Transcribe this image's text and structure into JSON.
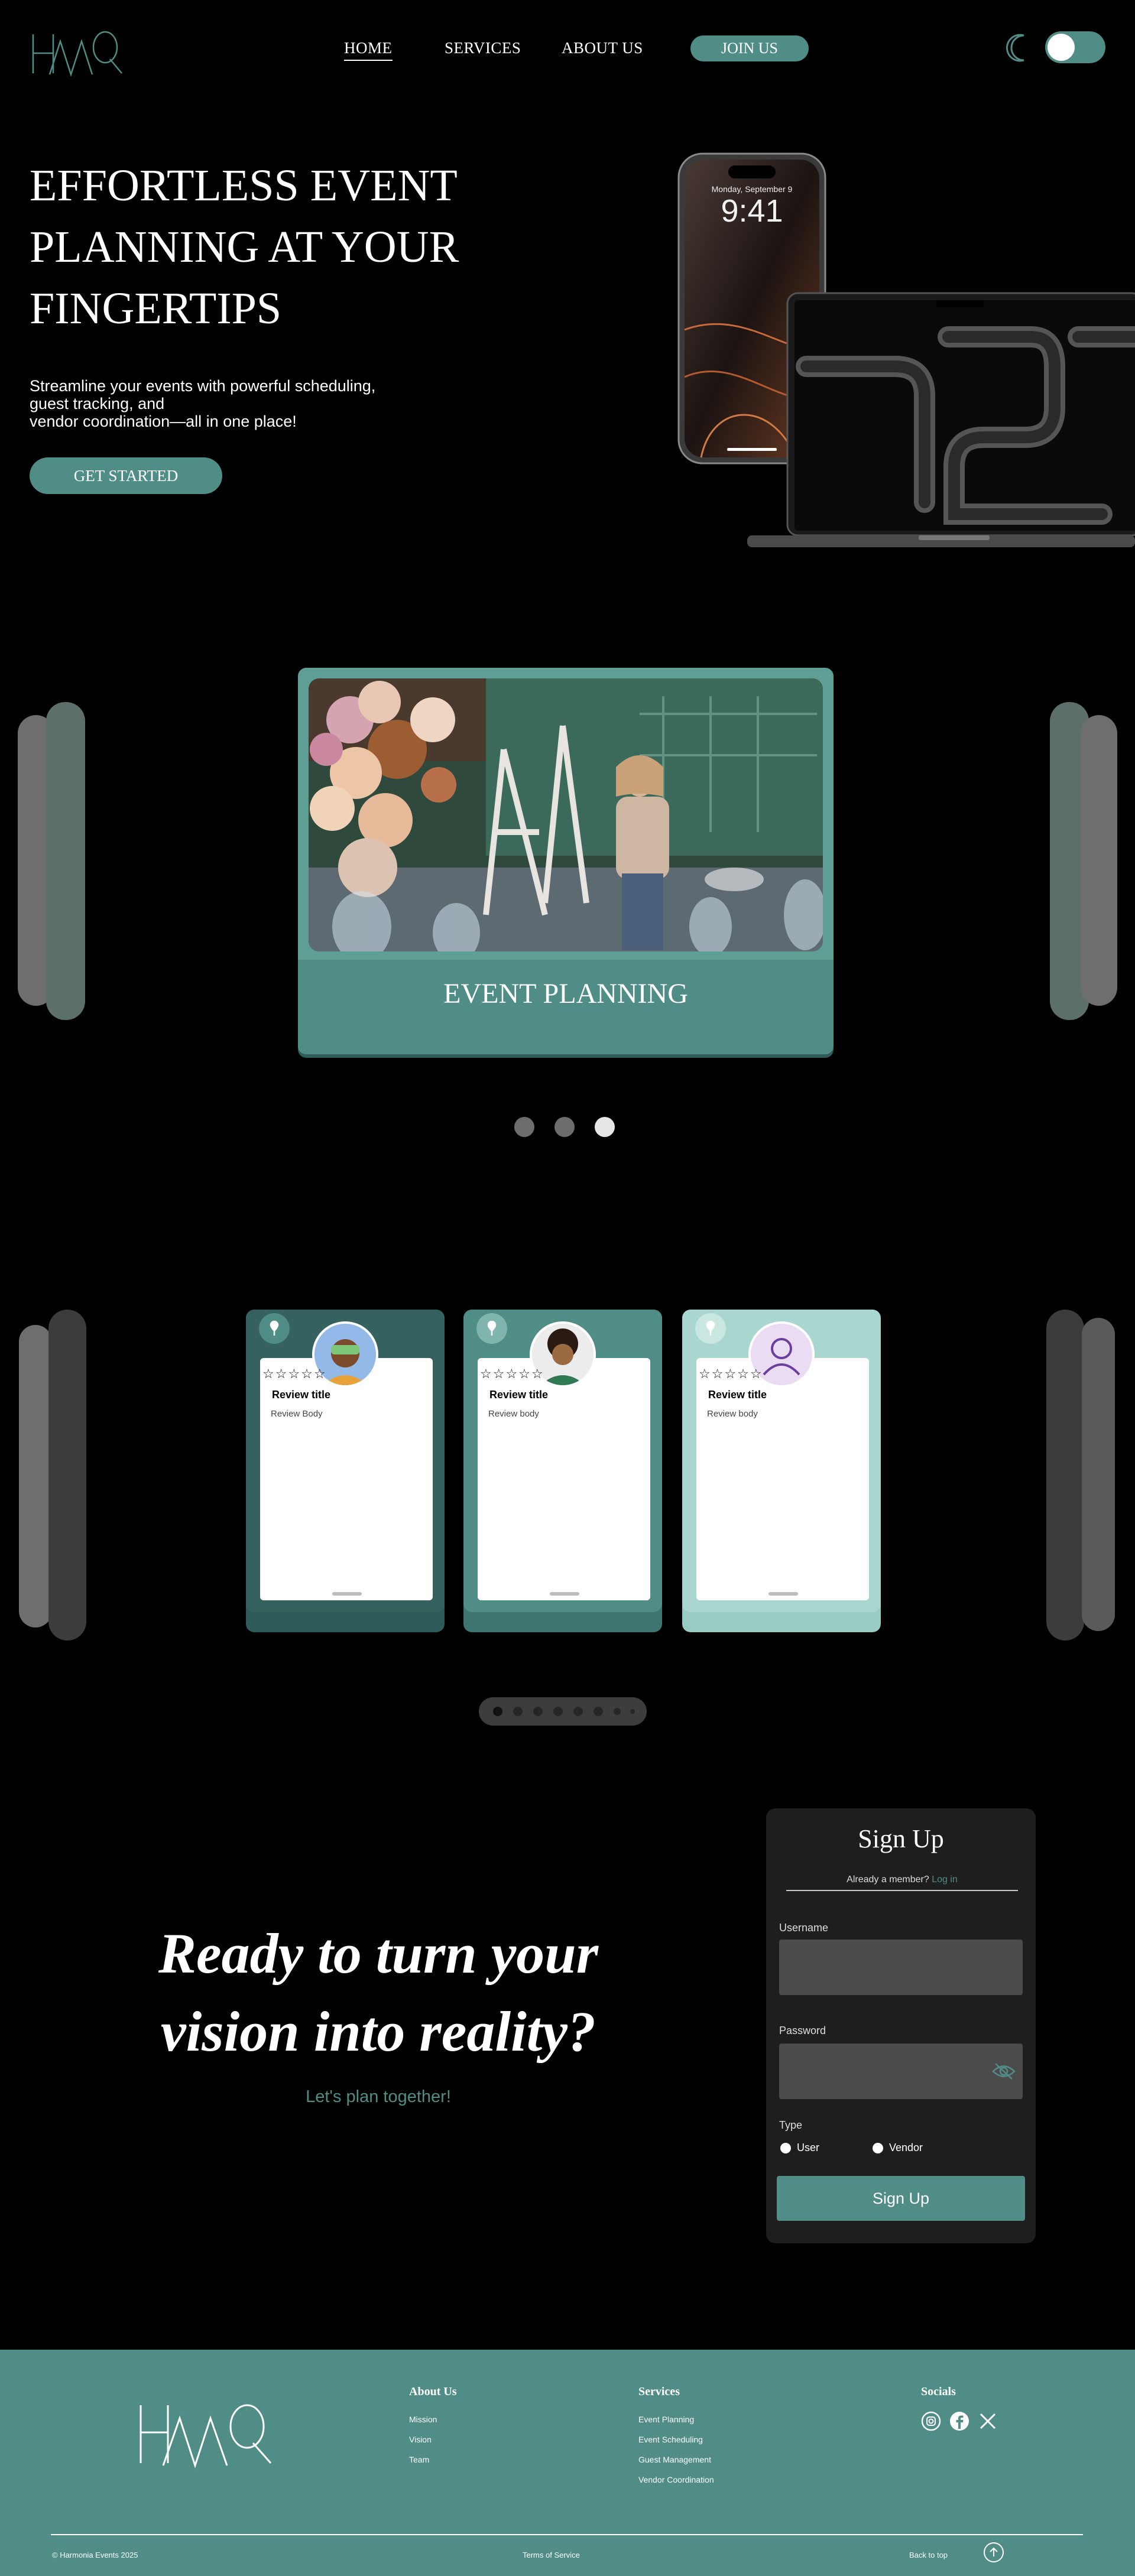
{
  "nav": {
    "logo": "HMQ",
    "links": [
      "HOME",
      "SERVICES",
      "ABOUT US"
    ],
    "join": "JOIN US"
  },
  "hero": {
    "title": "EFFORTLESS EVENT PLANNING AT YOUR FINGERTIPS",
    "subtitle_lines": [
      "Streamline your events with powerful scheduling,",
      "guest tracking, and",
      "vendor coordination—all in one place!"
    ],
    "cta": "GET STARTED",
    "phone_date": "Monday, September 9",
    "phone_time": "9:41"
  },
  "carousel": {
    "title": "EVENT PLANNING"
  },
  "reviews": [
    {
      "title": "Review title",
      "body": "Review Body",
      "stars": "☆☆☆☆☆"
    },
    {
      "title": "Review title",
      "body": "Review body",
      "stars": "☆☆☆☆☆"
    },
    {
      "title": "Review title",
      "body": "Review body",
      "stars": "☆☆☆☆☆"
    }
  ],
  "cta_section": {
    "line1": "Ready to turn your",
    "line2": "vision into reality?",
    "sub": "Let's plan together!"
  },
  "signup": {
    "title": "Sign Up",
    "member_text": "Already a member?",
    "login": "Log in",
    "username_label": "Username",
    "password_label": "Password",
    "type_label": "Type",
    "type_user": "User",
    "type_vendor": "Vendor",
    "submit": "Sign Up"
  },
  "footer": {
    "logo": "HMQ",
    "about_title": "About Us",
    "about_links": [
      "Mission",
      "Vision",
      "Team"
    ],
    "services_title": "Services",
    "services_links": [
      "Event Planning",
      "Event Scheduling",
      "Guest Management",
      "Vendor Coordination"
    ],
    "socials_title": "Socials",
    "copyright": "© Harmonia Events 2025",
    "terms": "Terms of Service",
    "back_to_top": "Back to top"
  },
  "colors": {
    "accent": "#4f8d86",
    "accent_light": "#a9d6ce",
    "accent_dark": "#35625d"
  }
}
